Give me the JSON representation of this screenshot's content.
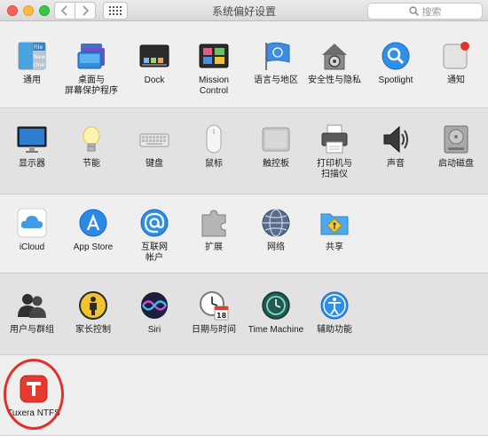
{
  "window": {
    "title": "系统偏好设置"
  },
  "search": {
    "placeholder": "搜索"
  },
  "rows": [
    [
      {
        "id": "general",
        "label": "通用"
      },
      {
        "id": "desktop",
        "label": "桌面与\n屏幕保护程序"
      },
      {
        "id": "dock",
        "label": "Dock"
      },
      {
        "id": "mission",
        "label": "Mission\nControl"
      },
      {
        "id": "language",
        "label": "语言与地区"
      },
      {
        "id": "security",
        "label": "安全性与隐私"
      },
      {
        "id": "spotlight",
        "label": "Spotlight"
      },
      {
        "id": "notifications",
        "label": "通知"
      }
    ],
    [
      {
        "id": "displays",
        "label": "显示器"
      },
      {
        "id": "energy",
        "label": "节能"
      },
      {
        "id": "keyboard",
        "label": "键盘"
      },
      {
        "id": "mouse",
        "label": "鼠标"
      },
      {
        "id": "trackpad",
        "label": "触控板"
      },
      {
        "id": "printers",
        "label": "打印机与\n扫描仪"
      },
      {
        "id": "sound",
        "label": "声音"
      },
      {
        "id": "startup",
        "label": "启动磁盘"
      }
    ],
    [
      {
        "id": "icloud",
        "label": "iCloud"
      },
      {
        "id": "appstore",
        "label": "App Store"
      },
      {
        "id": "internet",
        "label": "互联网\n帐户"
      },
      {
        "id": "extensions",
        "label": "扩展"
      },
      {
        "id": "network",
        "label": "网络"
      },
      {
        "id": "sharing",
        "label": "共享"
      }
    ],
    [
      {
        "id": "users",
        "label": "用户与群组"
      },
      {
        "id": "parental",
        "label": "家长控制"
      },
      {
        "id": "siri",
        "label": "Siri"
      },
      {
        "id": "datetime",
        "label": "日期与时间"
      },
      {
        "id": "timemachine",
        "label": "Time Machine"
      },
      {
        "id": "accessibility",
        "label": "辅助功能"
      }
    ],
    [
      {
        "id": "tuxera",
        "label": "Tuxera NTFS"
      }
    ]
  ],
  "icon_text": {
    "file": "File",
    "new": "New",
    "one": "One",
    "calendar_day": "18"
  },
  "colors": {
    "highlight": "#e0312a"
  }
}
